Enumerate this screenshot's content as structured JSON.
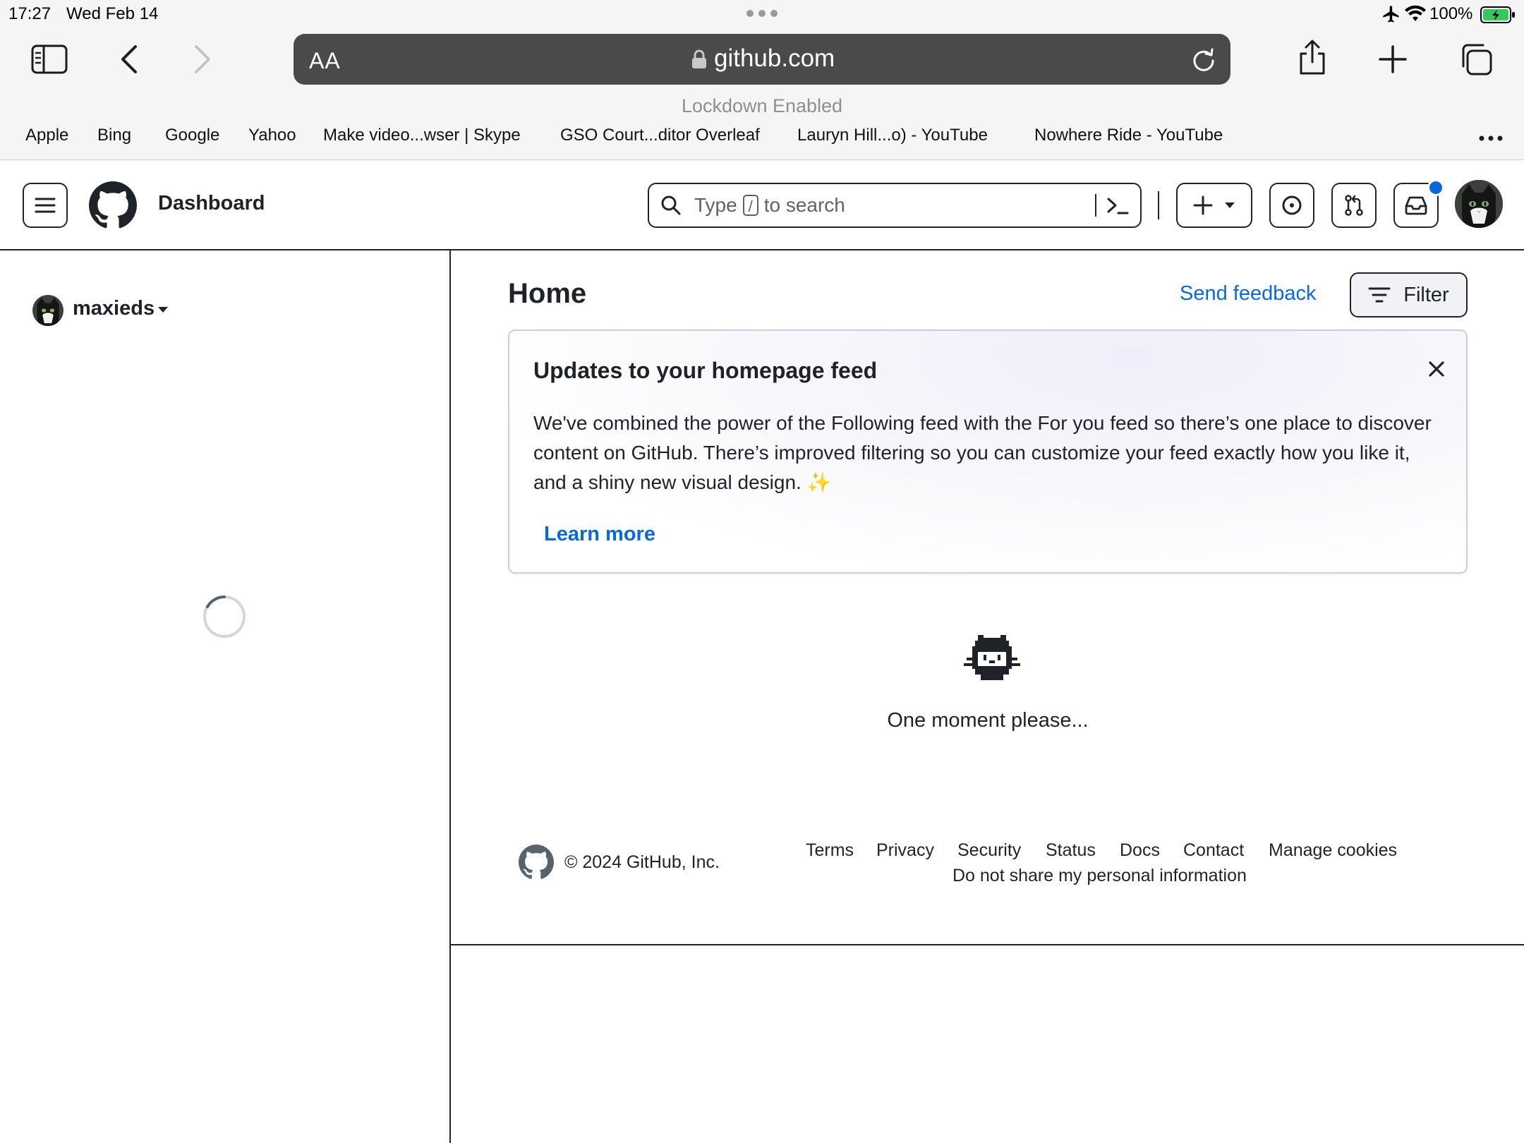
{
  "status_bar": {
    "time": "17:27",
    "date": "Wed Feb 14",
    "battery": "100%",
    "icons": [
      "airplane-icon",
      "wifi-icon",
      "battery-charging-icon"
    ]
  },
  "browser": {
    "url": "github.com",
    "text_size_label": "AA",
    "lockdown_notice": "Lockdown Enabled",
    "bookmarks": [
      "Apple",
      "Bing",
      "Google",
      "Yahoo",
      "Make video...wser | Skype",
      "GSO Court...ditor Overleaf",
      "Lauryn Hill...o) - YouTube",
      "Nowhere Ride - YouTube"
    ]
  },
  "header": {
    "title": "Dashboard",
    "search": {
      "prefix": "Type",
      "key": "/",
      "suffix": "to search"
    },
    "notification_color": "#0969da"
  },
  "sidebar": {
    "username": "maxieds"
  },
  "main": {
    "title": "Home",
    "send_feedback": "Send feedback",
    "filter_label": "Filter",
    "notice": {
      "title": "Updates to your homepage feed",
      "body": "We've combined the power of the Following feed with the For you feed so there’s one place to discover content on GitHub. There’s improved filtering so you can customize your feed exactly how you like it, and a shiny new visual design. ✨",
      "learn_more": "Learn more"
    },
    "loading_text": "One moment please..."
  },
  "footer": {
    "copyright": "© 2024 GitHub, Inc.",
    "links": [
      "Terms",
      "Privacy",
      "Security",
      "Status",
      "Docs",
      "Contact",
      "Manage cookies"
    ],
    "privacy_link": "Do not share my personal information"
  },
  "colors": {
    "link": "#0969da",
    "text": "#1f2328",
    "safari_url_bar": "#4a4a4a",
    "battery_green": "#34c759"
  }
}
